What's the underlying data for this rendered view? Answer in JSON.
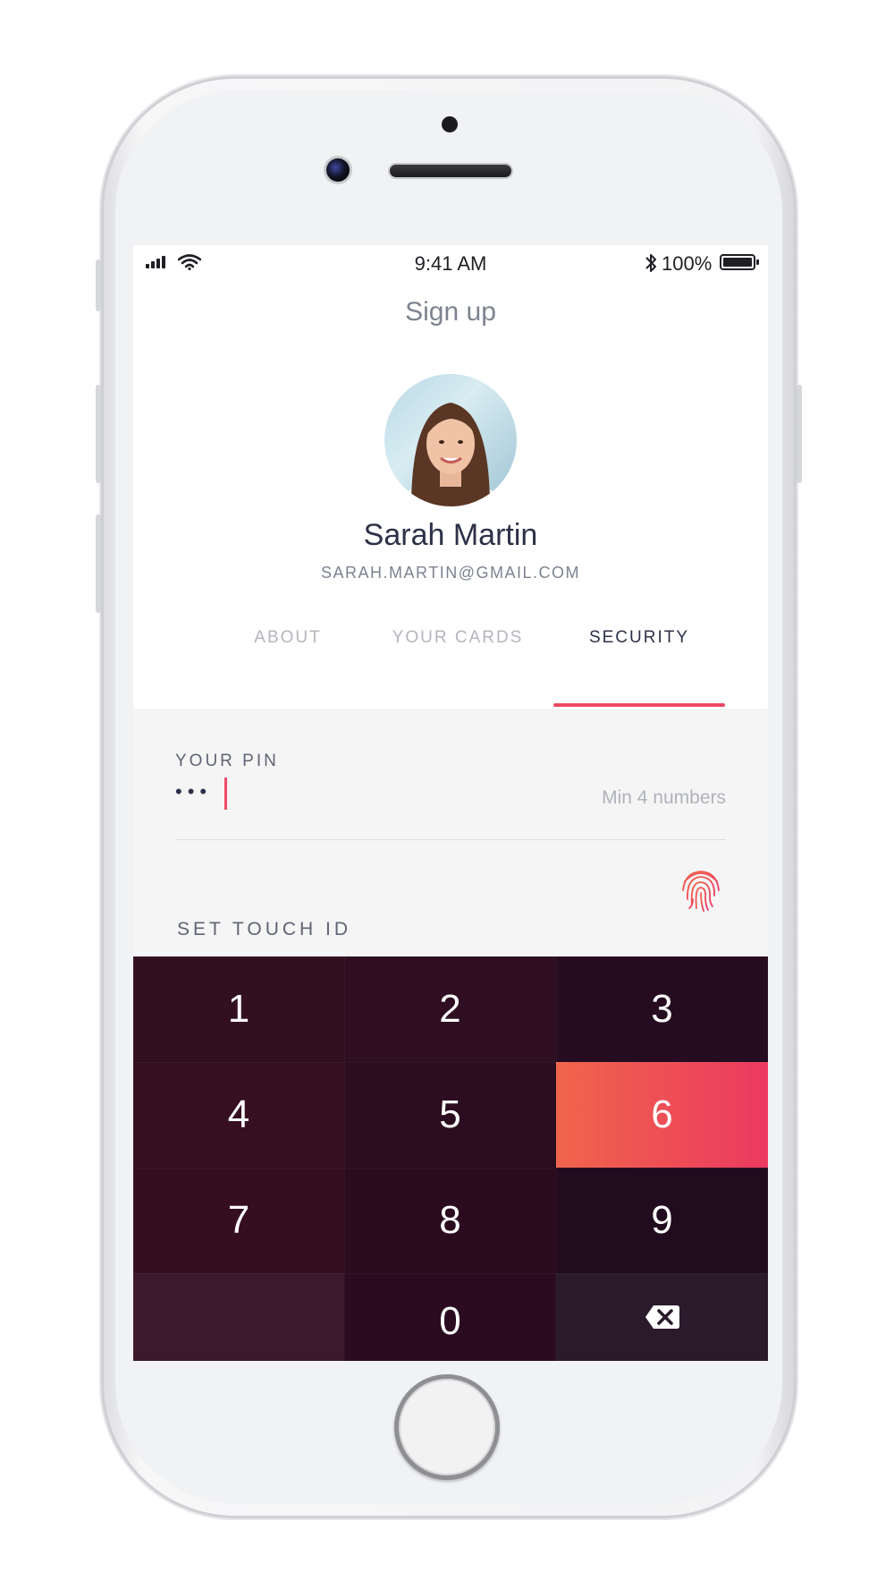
{
  "status_bar": {
    "time": "9:41 AM",
    "battery": "100%",
    "bluetooth_glyph": "✱",
    "icons": [
      "signal-icon",
      "wifi-icon",
      "bluetooth-icon",
      "battery-icon"
    ]
  },
  "header": {
    "title": "Sign up"
  },
  "profile": {
    "name": "Sarah Martin",
    "email": "SARAH.MARTIN@GMAIL.COM"
  },
  "tabs": [
    {
      "label": "ABOUT",
      "active": false
    },
    {
      "label": "YOUR CARDS",
      "active": false
    },
    {
      "label": "SECURITY",
      "active": true
    }
  ],
  "security": {
    "pin_label": "YOUR PIN",
    "pin_value": "•••",
    "pin_hint": "Min 4 numbers",
    "touch_id_label": "SET TOUCH ID"
  },
  "keypad": {
    "keys": [
      "1",
      "2",
      "3",
      "4",
      "5",
      "6",
      "7",
      "8",
      "9",
      "",
      "0",
      "⌫"
    ],
    "pressed_key": "6"
  },
  "colors": {
    "accent": "#ef4a62",
    "keypad_dark": "#2a0e20",
    "keypad_highlight_start": "#f0654b",
    "keypad_highlight_end": "#ec3960",
    "text_dark": "#2c3147",
    "text_muted": "#7d8390"
  }
}
